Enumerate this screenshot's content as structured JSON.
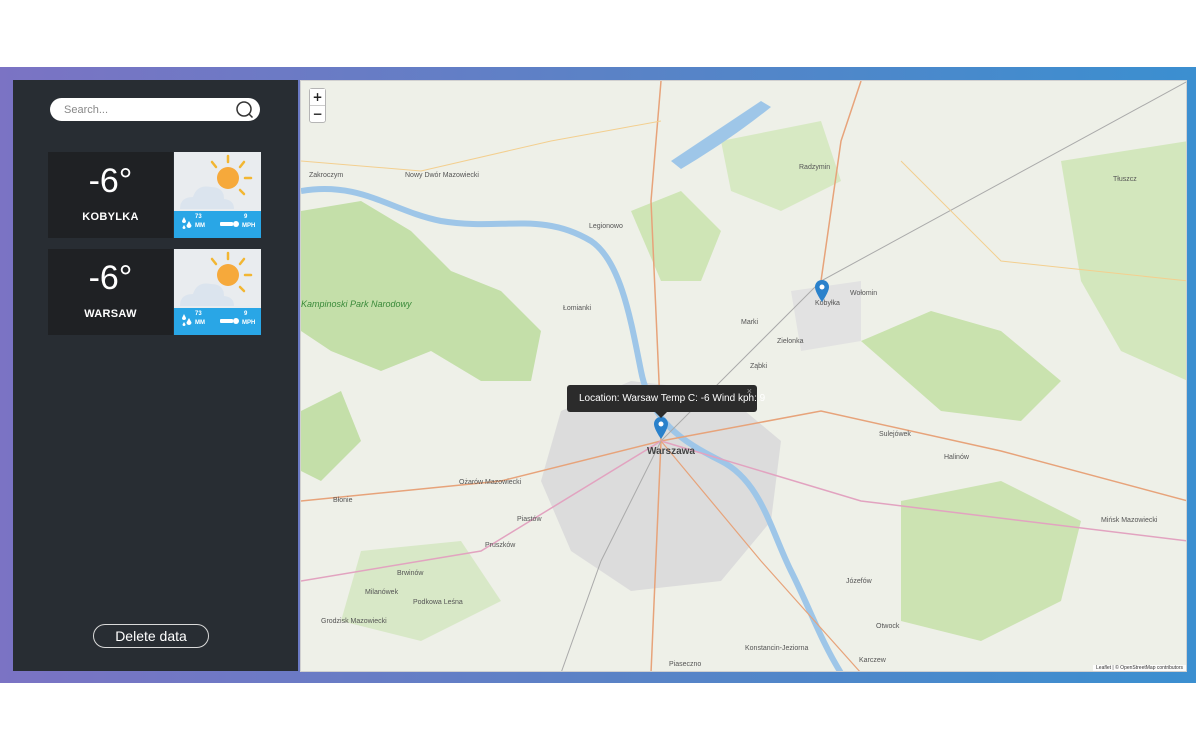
{
  "search": {
    "placeholder": "Search..."
  },
  "cards": [
    {
      "temp": "-6°",
      "city": "KOBYLKA",
      "precip_value": "73",
      "precip_unit": "MM",
      "wind_value": "9",
      "wind_unit": "MPH"
    },
    {
      "temp": "-6°",
      "city": "WARSAW",
      "precip_value": "73",
      "precip_unit": "MM",
      "wind_value": "9",
      "wind_unit": "MPH"
    }
  ],
  "sidebar": {
    "delete_label": "Delete data"
  },
  "map": {
    "zoom_in": "+",
    "zoom_out": "−",
    "popup_text": "Location: Warsaw Temp C: -6 Wind kph: 9",
    "popup_close": "×",
    "attribution": "Leaflet | © OpenStreetMap contributors",
    "labels": {
      "warszawa": "Warszawa",
      "kobylka": "Kobyłka",
      "legionowo": "Legionowo",
      "marki": "Marki",
      "zielonka": "Zielonka",
      "zabki": "Ząbki",
      "lomianki": "Łomianki",
      "radzymin": "Radzymin",
      "wolomin": "Wołomin",
      "sulejowek": "Sulejówek",
      "halinow": "Halinów",
      "minsk": "Mińsk Mazowiecki",
      "pruszkow": "Pruszków",
      "piastow": "Piastów",
      "ozarow": "Ożarów Mazowiecki",
      "blonie": "Błonie",
      "brwinow": "Brwinów",
      "milanowek": "Milanówek",
      "podkowa": "Podkowa Leśna",
      "grodzisk": "Grodzisk Mazowiecki",
      "jozefow": "Józefów",
      "otwock": "Otwock",
      "karczew": "Karczew",
      "konstancin": "Konstancin-Jeziorna",
      "piaseczno": "Piaseczno",
      "zakroczym": "Zakroczym",
      "nowydwor": "Nowy Dwór Mazowiecki",
      "tluszcz": "Tłuszcz",
      "kampinoski": "Kampinoski Park Narodowy"
    }
  },
  "colors": {
    "sidebar": "#282d33",
    "card": "#1f2124",
    "stats": "#29a6e6",
    "marker": "#2a81cb"
  }
}
